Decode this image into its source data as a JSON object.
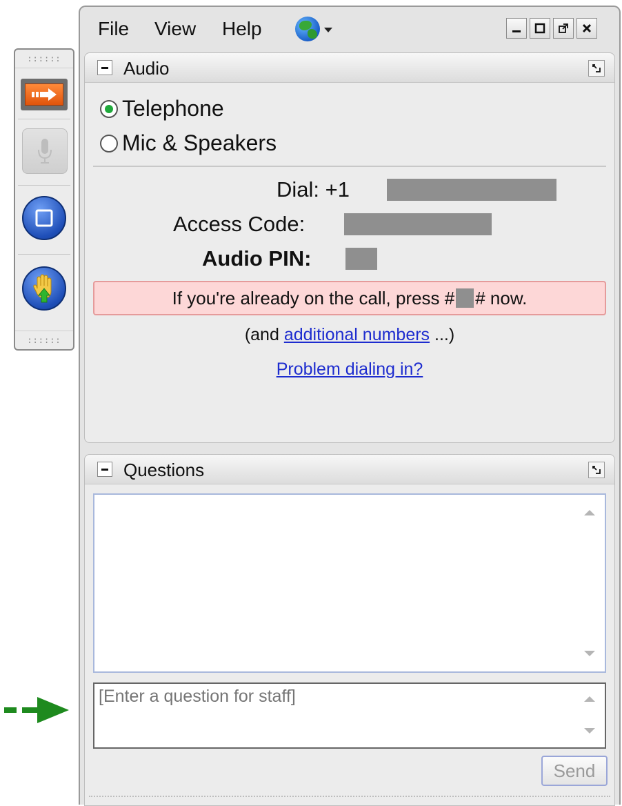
{
  "menu": {
    "file": "File",
    "view": "View",
    "help": "Help",
    "language_icon": "globe-icon"
  },
  "window_controls": [
    "minimize-icon",
    "maximize-icon",
    "popout-icon",
    "close-icon"
  ],
  "toolbar": {
    "grip": "::::::",
    "buttons": [
      "arrow-right-icon",
      "microphone-icon",
      "stop-icon",
      "raise-hand-icon"
    ]
  },
  "audio_panel": {
    "title": "Audio",
    "options": [
      {
        "label": "Telephone",
        "selected": true
      },
      {
        "label": "Mic & Speakers",
        "selected": false
      }
    ],
    "dial_label": "Dial: +1",
    "access_code_label": "Access Code:",
    "audio_pin_label": "Audio PIN:",
    "notice_prefix": "If you're already on the call, press #",
    "notice_suffix": "# now.",
    "more_prefix": "(and ",
    "more_link": "additional numbers",
    "more_suffix": " ...)",
    "problem_link": "Problem dialing in?"
  },
  "questions_panel": {
    "title": "Questions",
    "input_placeholder": "[Enter a question for staff]",
    "send_label": "Send"
  },
  "colors": {
    "notice_bg": "#fdd7d7",
    "notice_border": "#e59b9b",
    "link": "#1d2ccf",
    "radio_selected": "#1fa83b",
    "annotation_arrow": "#1e8a1e"
  }
}
